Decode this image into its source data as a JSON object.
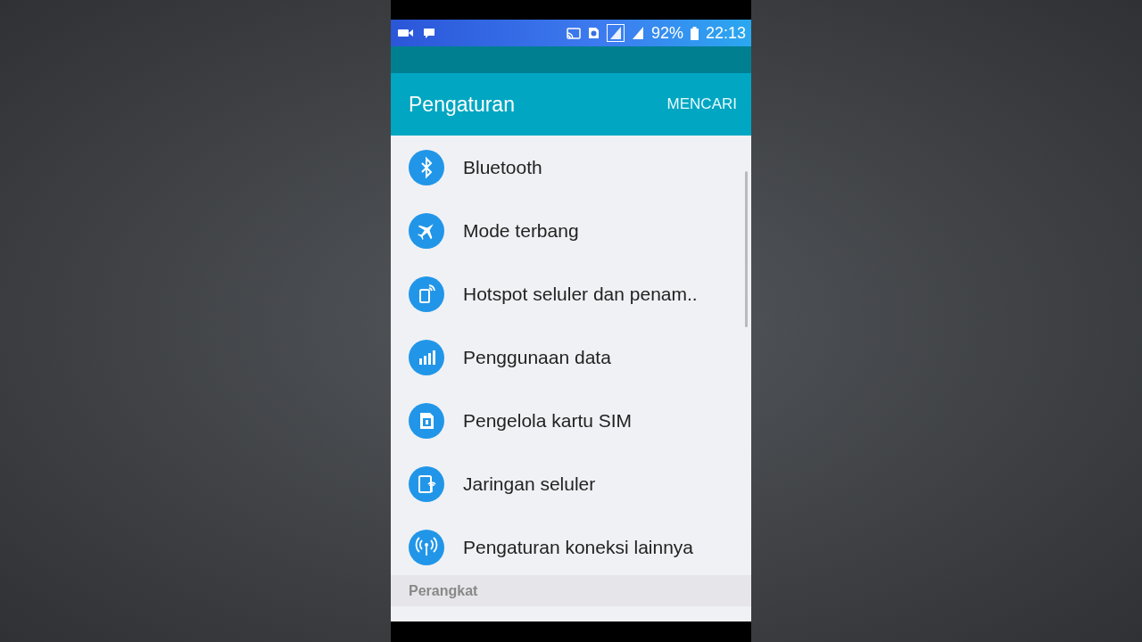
{
  "status_bar": {
    "battery": "92%",
    "time": "22:13"
  },
  "app_bar": {
    "title": "Pengaturan",
    "action": "MENCARI"
  },
  "items": [
    {
      "kind": "bluetooth",
      "label": "Bluetooth"
    },
    {
      "kind": "airplane",
      "label": "Mode terbang"
    },
    {
      "kind": "hotspot",
      "label": "Hotspot seluler dan penam.."
    },
    {
      "kind": "data",
      "label": "Penggunaan data"
    },
    {
      "kind": "sim",
      "label": "Pengelola kartu SIM"
    },
    {
      "kind": "network",
      "label": "Jaringan seluler"
    },
    {
      "kind": "connection",
      "label": "Pengaturan koneksi lainnya"
    }
  ],
  "section": {
    "title": "Perangkat"
  }
}
